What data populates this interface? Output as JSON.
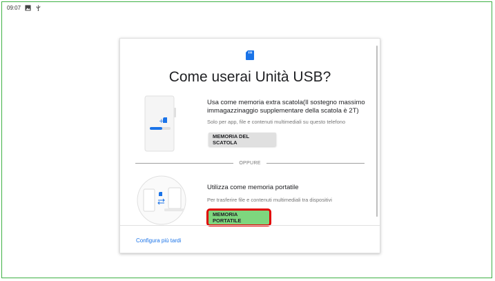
{
  "statusbar": {
    "time": "09:07",
    "icons": [
      "image-icon",
      "usb-icon"
    ]
  },
  "dialog": {
    "icon": "sd-card-icon",
    "title": "Come userai Unità USB?",
    "option1": {
      "title": "Usa come memoria extra scatola(Il sostegno massimo immagazzinaggio supplementare della scatola è 2T)",
      "subtitle": "Solo per app, file e contenuti multimediali su questo telefono",
      "button": "MEMORIA DEL SCATOLA"
    },
    "divider_text": "OPPURE",
    "option2": {
      "title": "Utilizza come memoria portatile",
      "subtitle": "Per trasferire file e contenuti multimediali tra dispositivi",
      "button": "MEMORIA PORTATILE"
    },
    "later_link": "Configura più tardi"
  },
  "colors": {
    "accent": "#1a73e8",
    "highlight_border": "#e00000",
    "highlight_fill": "#7ed67e",
    "frame": "#3cb043"
  }
}
